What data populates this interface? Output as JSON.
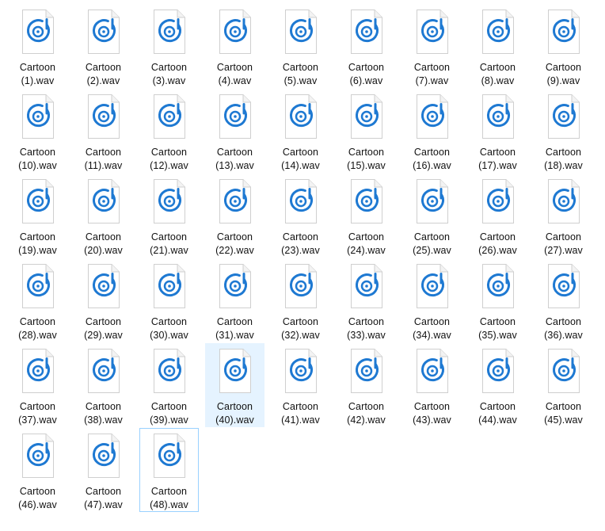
{
  "colors": {
    "accent": "#1e79d2",
    "hover_bg": "#e5f3ff",
    "focus_border": "#99d1ff"
  },
  "icon_name": "audio-file-icon",
  "files": [
    {
      "line1": "Cartoon",
      "line2": "(1).wav"
    },
    {
      "line1": "Cartoon",
      "line2": "(2).wav"
    },
    {
      "line1": "Cartoon",
      "line2": "(3).wav"
    },
    {
      "line1": "Cartoon",
      "line2": "(4).wav"
    },
    {
      "line1": "Cartoon",
      "line2": "(5).wav"
    },
    {
      "line1": "Cartoon",
      "line2": "(6).wav"
    },
    {
      "line1": "Cartoon",
      "line2": "(7).wav"
    },
    {
      "line1": "Cartoon",
      "line2": "(8).wav"
    },
    {
      "line1": "Cartoon",
      "line2": "(9).wav"
    },
    {
      "line1": "Cartoon",
      "line2": "(10).wav"
    },
    {
      "line1": "Cartoon",
      "line2": "(11).wav"
    },
    {
      "line1": "Cartoon",
      "line2": "(12).wav"
    },
    {
      "line1": "Cartoon",
      "line2": "(13).wav"
    },
    {
      "line1": "Cartoon",
      "line2": "(14).wav"
    },
    {
      "line1": "Cartoon",
      "line2": "(15).wav"
    },
    {
      "line1": "Cartoon",
      "line2": "(16).wav"
    },
    {
      "line1": "Cartoon",
      "line2": "(17).wav"
    },
    {
      "line1": "Cartoon",
      "line2": "(18).wav"
    },
    {
      "line1": "Cartoon",
      "line2": "(19).wav"
    },
    {
      "line1": "Cartoon",
      "line2": "(20).wav"
    },
    {
      "line1": "Cartoon",
      "line2": "(21).wav"
    },
    {
      "line1": "Cartoon",
      "line2": "(22).wav"
    },
    {
      "line1": "Cartoon",
      "line2": "(23).wav"
    },
    {
      "line1": "Cartoon",
      "line2": "(24).wav"
    },
    {
      "line1": "Cartoon",
      "line2": "(25).wav"
    },
    {
      "line1": "Cartoon",
      "line2": "(26).wav"
    },
    {
      "line1": "Cartoon",
      "line2": "(27).wav"
    },
    {
      "line1": "Cartoon",
      "line2": "(28).wav"
    },
    {
      "line1": "Cartoon",
      "line2": "(29).wav"
    },
    {
      "line1": "Cartoon",
      "line2": "(30).wav"
    },
    {
      "line1": "Cartoon",
      "line2": "(31).wav"
    },
    {
      "line1": "Cartoon",
      "line2": "(32).wav"
    },
    {
      "line1": "Cartoon",
      "line2": "(33).wav"
    },
    {
      "line1": "Cartoon",
      "line2": "(34).wav"
    },
    {
      "line1": "Cartoon",
      "line2": "(35).wav"
    },
    {
      "line1": "Cartoon",
      "line2": "(36).wav"
    },
    {
      "line1": "Cartoon",
      "line2": "(37).wav"
    },
    {
      "line1": "Cartoon",
      "line2": "(38).wav"
    },
    {
      "line1": "Cartoon",
      "line2": "(39).wav"
    },
    {
      "line1": "Cartoon",
      "line2": "(40).wav",
      "state": "hovered"
    },
    {
      "line1": "Cartoon",
      "line2": "(41).wav"
    },
    {
      "line1": "Cartoon",
      "line2": "(42).wav"
    },
    {
      "line1": "Cartoon",
      "line2": "(43).wav"
    },
    {
      "line1": "Cartoon",
      "line2": "(44).wav"
    },
    {
      "line1": "Cartoon",
      "line2": "(45).wav"
    },
    {
      "line1": "Cartoon",
      "line2": "(46).wav"
    },
    {
      "line1": "Cartoon",
      "line2": "(47).wav"
    },
    {
      "line1": "Cartoon",
      "line2": "(48).wav",
      "state": "focused"
    }
  ]
}
